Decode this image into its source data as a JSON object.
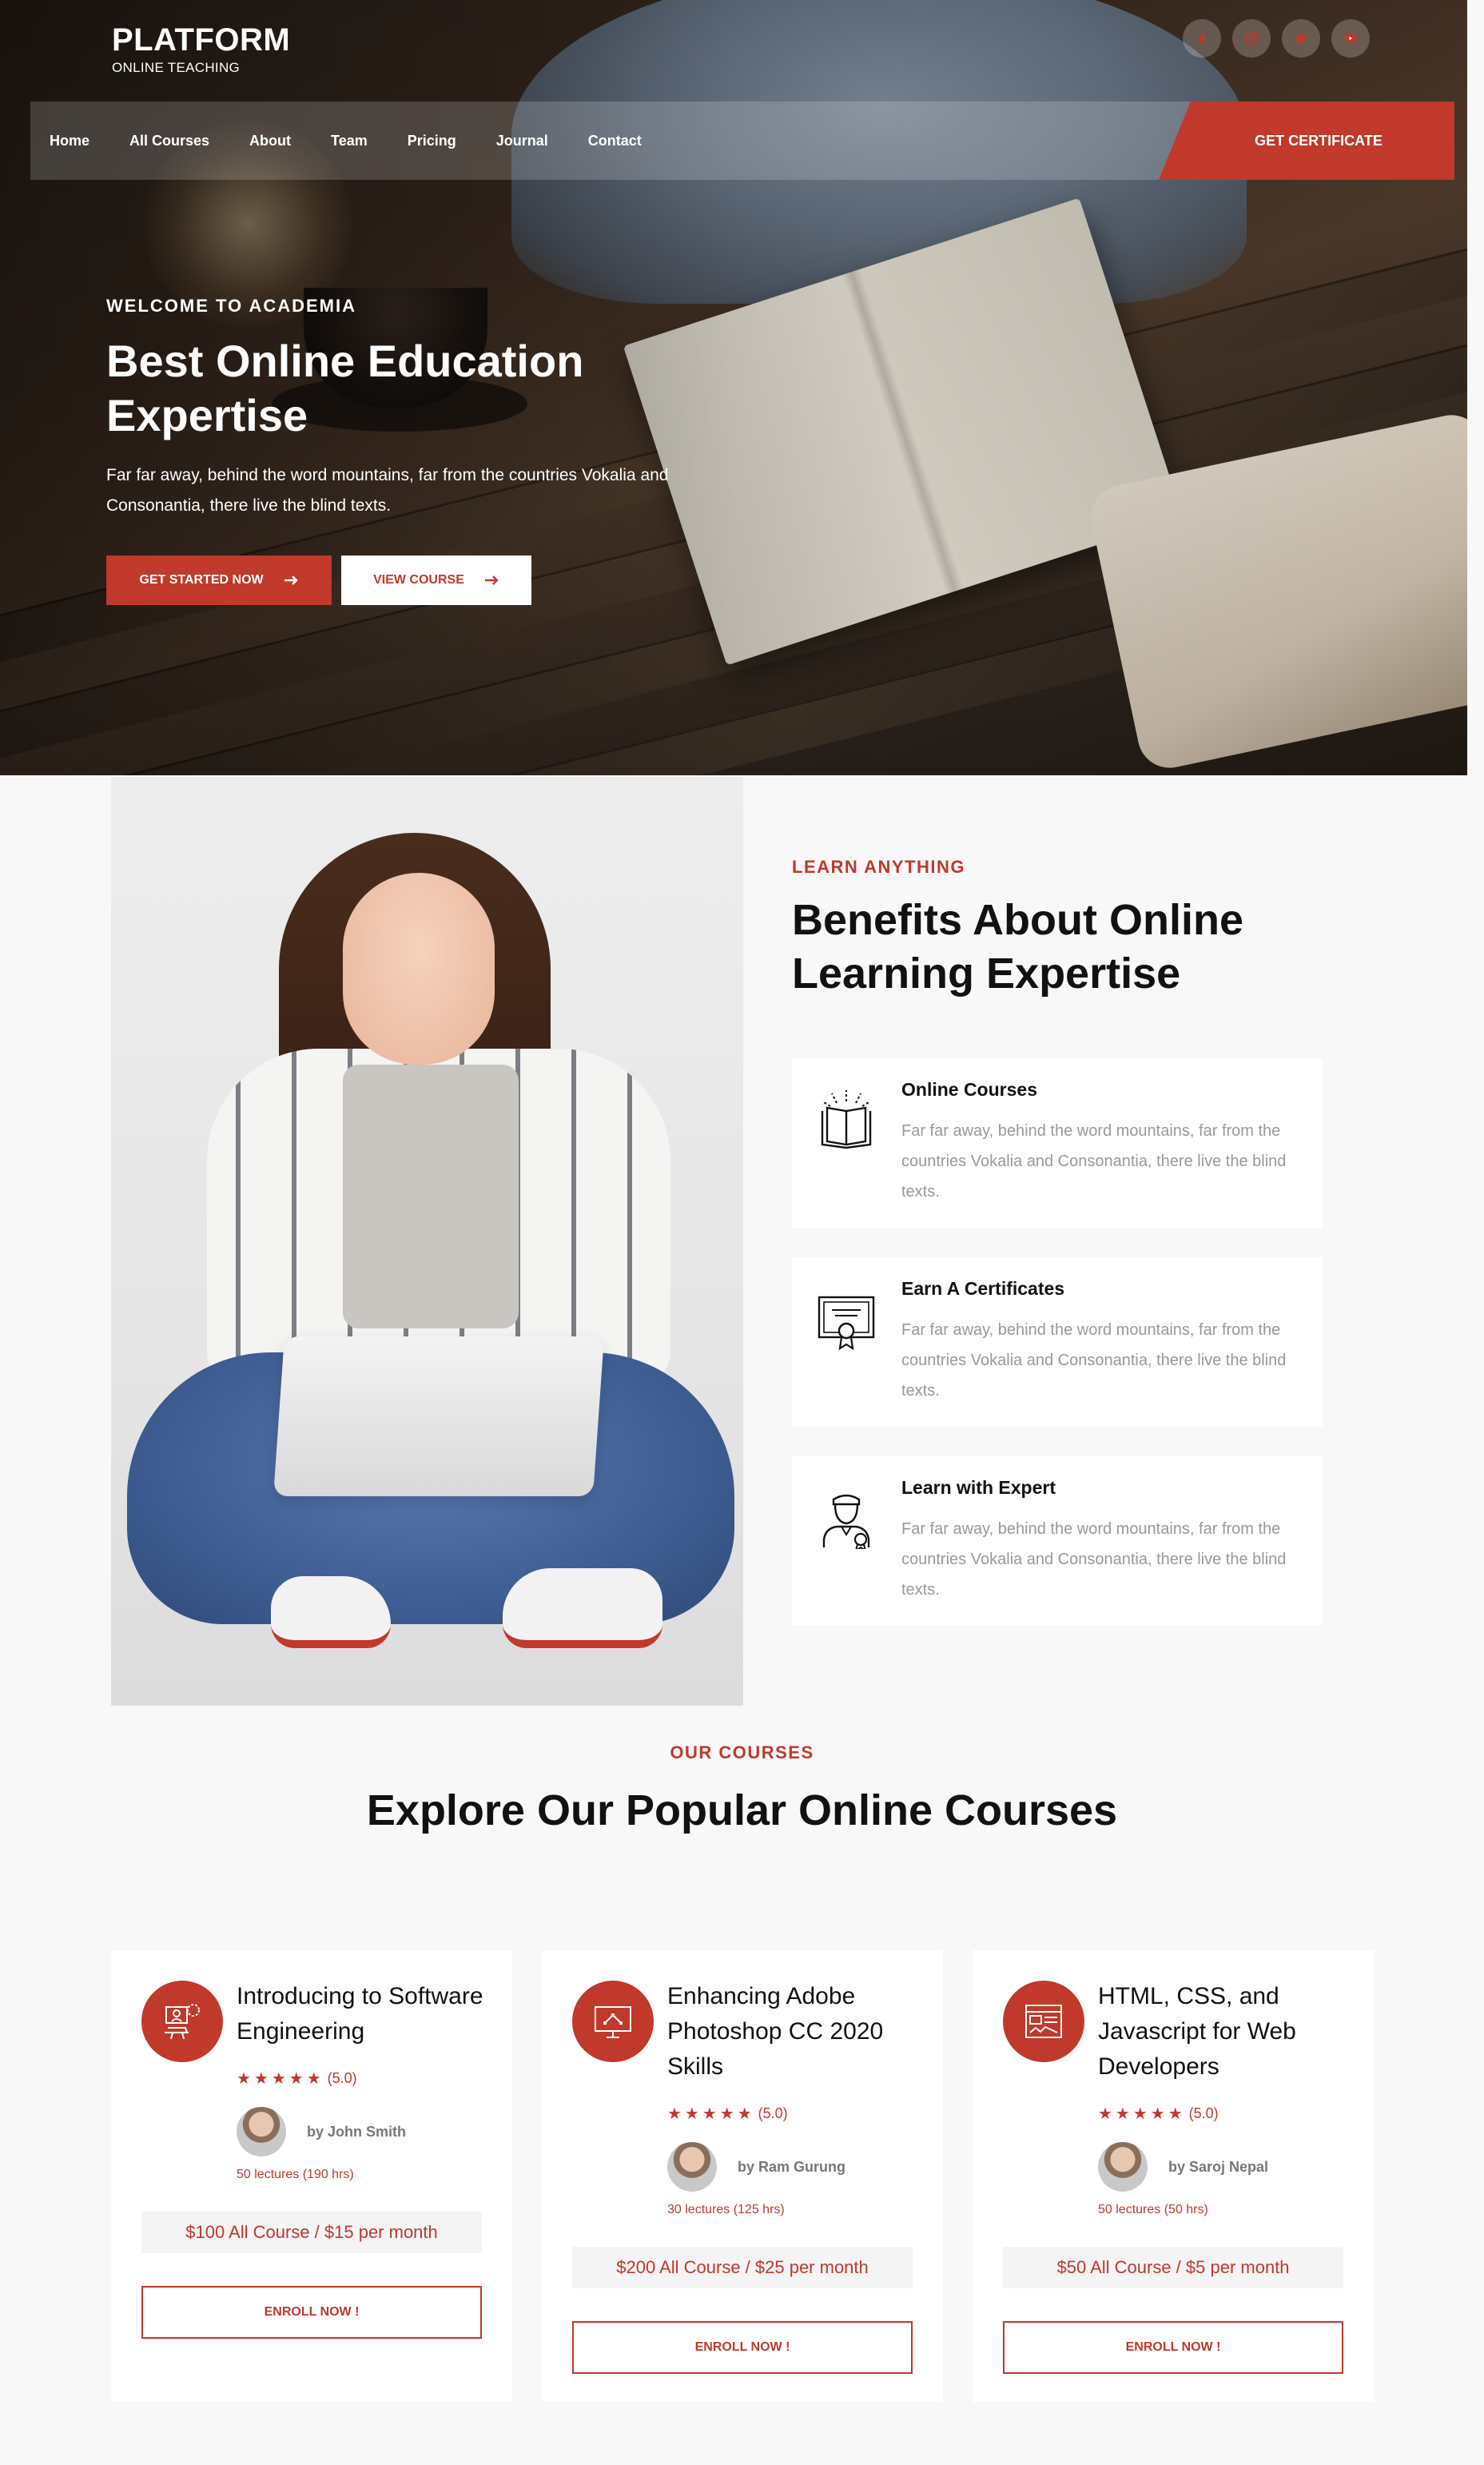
{
  "brand": {
    "name": "PLATFORM",
    "tagline": "ONLINE TEACHING"
  },
  "socials": [
    {
      "icon": "facebook-icon"
    },
    {
      "icon": "instagram-icon"
    },
    {
      "icon": "twitter-icon"
    },
    {
      "icon": "youtube-icon"
    }
  ],
  "nav": {
    "items": [
      "Home",
      "All Courses",
      "About",
      "Team",
      "Pricing",
      "Journal",
      "Contact"
    ],
    "cta": "GET CERTIFICATE"
  },
  "hero": {
    "kicker": "WELCOME TO ACADEMIA",
    "title": "Best Online Education Expertise",
    "text": "Far far away, behind the word mountains, far from the countries Vokalia and Consonantia, there live the blind texts.",
    "primary_btn": "GET STARTED NOW",
    "secondary_btn": "VIEW COURSE"
  },
  "benefits": {
    "kicker": "LEARN ANYTHING",
    "title": "Benefits About Online Learning Expertise",
    "items": [
      {
        "icon": "open-book-icon",
        "title": "Online Courses",
        "text": "Far far away, behind the word mountains, far from the countries Vokalia and Consonantia, there live the blind texts."
      },
      {
        "icon": "certificate-icon",
        "title": "Earn A Certificates",
        "text": "Far far away, behind the word mountains, far from the countries Vokalia and Consonantia, there live the blind texts."
      },
      {
        "icon": "expert-teacher-icon",
        "title": "Learn with Expert",
        "text": "Far far away, behind the word mountains, far from the countries Vokalia and Consonantia, there live the blind texts."
      }
    ]
  },
  "courses": {
    "kicker": "OUR COURSES",
    "title": "Explore Our Popular Online Courses",
    "items": [
      {
        "icon": "engineering-icon",
        "title": "Introducing to Software Engineering",
        "rating": "(5.0)",
        "stars": "★★★★★",
        "author": "by John Smith",
        "lectures": "50 lectures (190 hrs)",
        "price": "$100 All Course / $15 per month",
        "enroll": "ENROLL NOW !"
      },
      {
        "icon": "design-monitor-icon",
        "title": "Enhancing Adobe Photoshop CC 2020 Skills",
        "rating": "(5.0)",
        "stars": "★★★★★",
        "author": "by Ram Gurung",
        "lectures": "30 lectures (125 hrs)",
        "price": "$200 All Course / $25 per month",
        "enroll": "ENROLL NOW !"
      },
      {
        "icon": "web-code-icon",
        "title": "HTML, CSS, and Javascript for Web Developers",
        "rating": "(5.0)",
        "stars": "★★★★★",
        "author": "by Saroj Nepal",
        "lectures": "50 lectures (50 hrs)",
        "price": "$50 All Course / $5 per month",
        "enroll": "ENROLL NOW !"
      }
    ]
  },
  "colors": {
    "accent": "#c0392b",
    "text": "#111111",
    "muted": "#999999",
    "background": "#f8f8f8"
  }
}
